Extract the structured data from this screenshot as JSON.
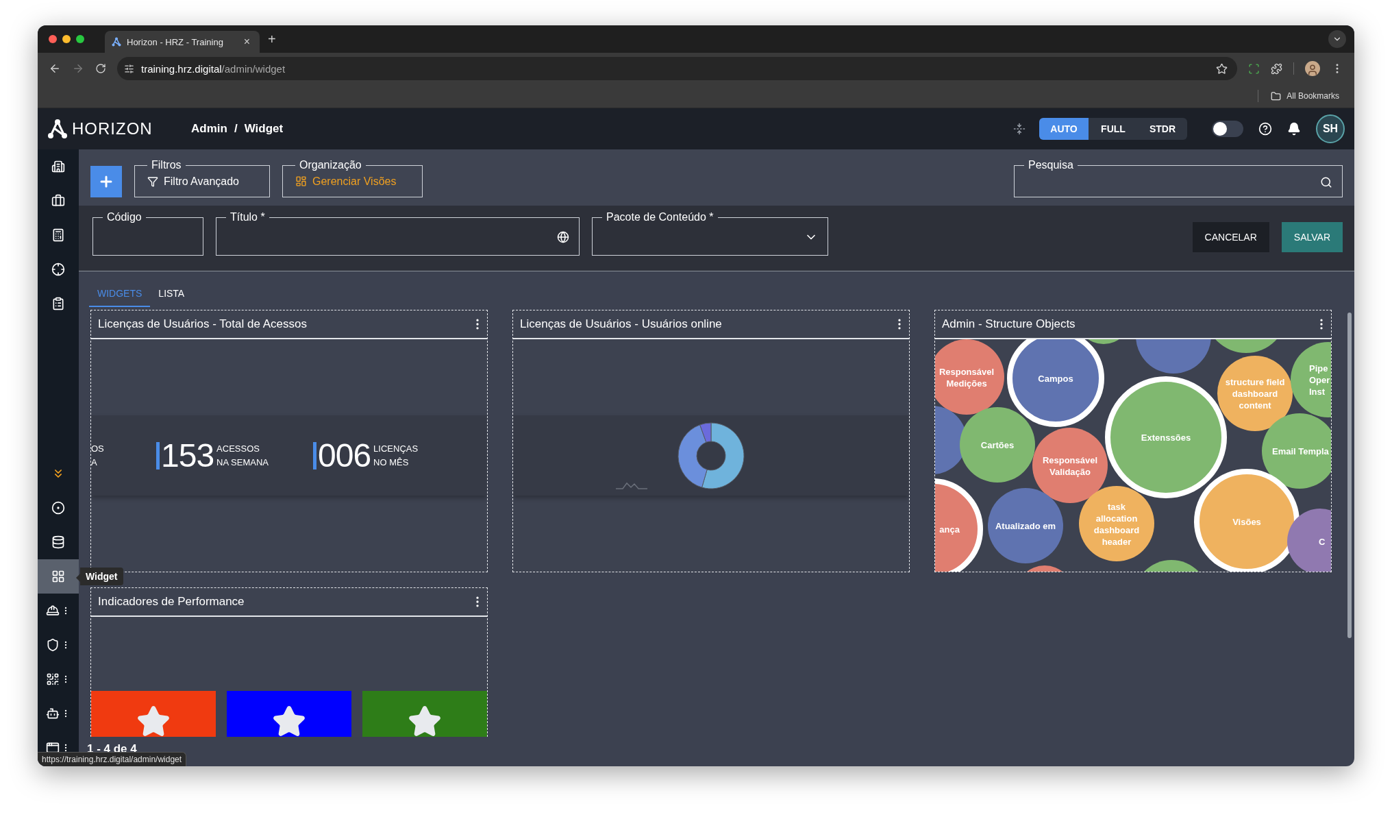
{
  "browser": {
    "tab": {
      "title": "Horizon - HRZ - Training",
      "close": "×"
    },
    "new_tab": "+",
    "url": {
      "host": "training.hrz.digital",
      "path": "/admin/widget"
    },
    "bookmarks": "All Bookmarks",
    "status_url": "https://training.hrz.digital/admin/widget"
  },
  "header": {
    "logo": "HORIZON",
    "breadcrumb": [
      "Admin",
      "Widget"
    ],
    "separator": "/",
    "modes": [
      {
        "label": "AUTO",
        "selected": true
      },
      {
        "label": "FULL",
        "selected": false
      },
      {
        "label": "STDR",
        "selected": false
      }
    ],
    "dark_toggle": {
      "on": false
    },
    "avatar": "SH"
  },
  "sidebar": {
    "tooltip": "Widget",
    "items": [
      {
        "kind": "link",
        "selected": false,
        "menu": false
      },
      {
        "kind": "link",
        "selected": false,
        "menu": false
      },
      {
        "kind": "link",
        "selected": false,
        "menu": false
      },
      {
        "kind": "link",
        "selected": false,
        "menu": false
      },
      {
        "kind": "link",
        "selected": false,
        "menu": false
      },
      {
        "kind": "expand",
        "selected": false,
        "menu": false
      },
      {
        "kind": "link",
        "selected": false,
        "menu": false
      },
      {
        "kind": "link",
        "selected": false,
        "menu": false
      },
      {
        "kind": "link",
        "selected": true,
        "menu": false
      },
      {
        "kind": "link",
        "selected": false,
        "menu": true
      },
      {
        "kind": "link",
        "selected": false,
        "menu": true
      },
      {
        "kind": "link",
        "selected": false,
        "menu": true
      },
      {
        "kind": "link",
        "selected": false,
        "menu": true
      },
      {
        "kind": "link",
        "selected": false,
        "menu": true
      }
    ]
  },
  "toolbar": {
    "filters": {
      "legend": "Filtros",
      "button": "Filtro Avançado"
    },
    "organization": {
      "legend": "Organização",
      "button": "Gerenciar Visões"
    },
    "search": {
      "legend": "Pesquisa"
    }
  },
  "form": {
    "fields": [
      {
        "label": "Código",
        "kind": "text"
      },
      {
        "label": "Título *",
        "kind": "localized"
      },
      {
        "label": "Pacote de Conteúdo *",
        "kind": "select"
      }
    ],
    "buttons": [
      {
        "label": "CANCELAR",
        "kind": "secondary"
      },
      {
        "label": "SALVAR",
        "kind": "primary"
      }
    ]
  },
  "tabs": [
    {
      "label": "WIDGETS",
      "selected": true
    },
    {
      "label": "LISTA",
      "selected": false
    }
  ],
  "widgets": [
    {
      "title": "Licenças de Usuários - Total de Acessos",
      "kind": "stats",
      "stats": [
        {
          "lines": [
            "OS",
            "A"
          ]
        },
        {
          "value": "153",
          "lines": [
            "ACESSOS",
            "NA SEMANA"
          ]
        },
        {
          "value": "006",
          "lines": [
            "LICENÇAS",
            "NO MÊS"
          ]
        }
      ]
    },
    {
      "title": "Licenças de Usuários - Usuários online",
      "kind": "donut"
    },
    {
      "title": "Admin - Structure Objects",
      "kind": "bubbles",
      "bubbles": [
        {
          "color": "#80b870",
          "ringed": false
        },
        {
          "color": "#5f73b0",
          "ringed": false
        },
        {
          "color": "#80b870",
          "ringed": false
        },
        {
          "color": "#e07e70",
          "ringed": false,
          "lines": [
            "Responsável",
            "Medições"
          ]
        },
        {
          "color": "#5f73b0",
          "ringed": true,
          "lines": [
            "Campos"
          ]
        },
        {
          "color": "#efb25f",
          "ringed": false,
          "lines": [
            "structure field",
            "dashboard",
            "content"
          ]
        },
        {
          "color": "#80b870",
          "ringed": false,
          "lines": [
            "Pipe",
            "Oper",
            "Inst"
          ]
        },
        {
          "color": "#5f73b0",
          "ringed": false
        },
        {
          "color": "#80b870",
          "ringed": false,
          "lines": [
            "Cartões"
          ]
        },
        {
          "color": "#e07e70",
          "ringed": false,
          "lines": [
            "Responsável",
            "Validação"
          ]
        },
        {
          "color": "#80b870",
          "ringed": true,
          "lines": [
            "Extenssões"
          ]
        },
        {
          "color": "#80b870",
          "ringed": false,
          "lines": [
            "Email Templa"
          ]
        },
        {
          "color": "#e07e70",
          "ringed": true,
          "lines": [
            "ança"
          ]
        },
        {
          "color": "#5f73b0",
          "ringed": false,
          "lines": [
            "Atualizado em"
          ]
        },
        {
          "color": "#efb25f",
          "ringed": false,
          "lines": [
            "task",
            "allocation",
            "dashboard",
            "header"
          ]
        },
        {
          "color": "#efb25f",
          "ringed": true,
          "lines": [
            "Visões"
          ]
        },
        {
          "color": "#9079b0",
          "ringed": false,
          "lines": [
            "C"
          ]
        },
        {
          "color": "#80b870",
          "ringed": false
        },
        {
          "color": "#e07e70",
          "ringed": false
        }
      ]
    },
    {
      "title": "Indicadores de Performance",
      "kind": "tiles",
      "tiles": [
        {
          "color": "#f03a10"
        },
        {
          "color": "#0000ff"
        },
        {
          "color": "#2e7d18"
        }
      ]
    }
  ],
  "pagination": "1 - 4 de 4"
}
